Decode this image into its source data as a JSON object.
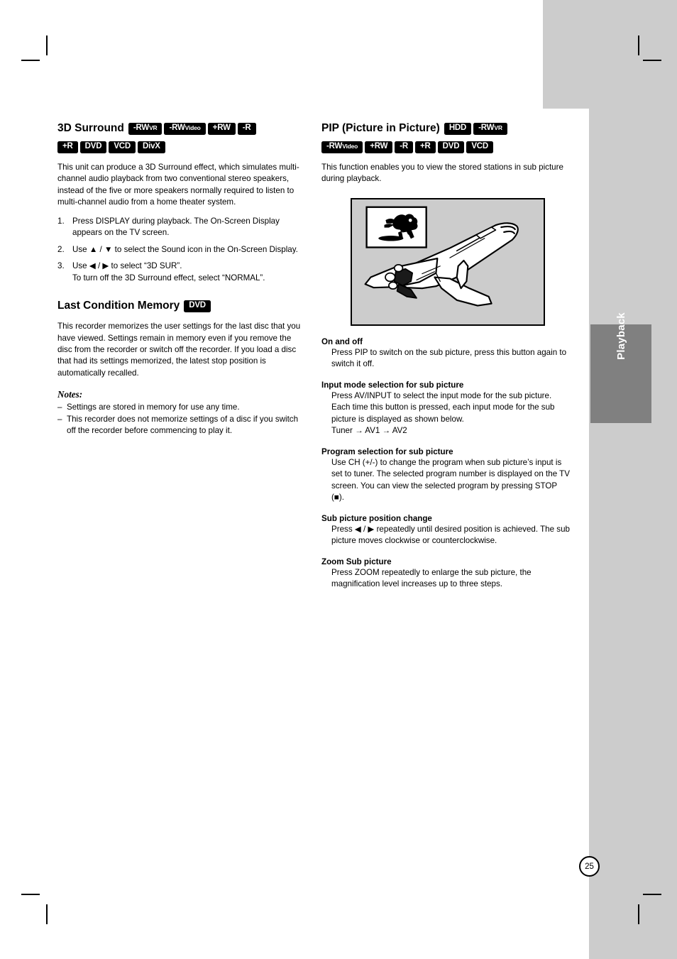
{
  "page": {
    "number": "25",
    "side_tab_label": "Playback"
  },
  "left_column": {
    "section1": {
      "title": "3D Surround",
      "badges": [
        {
          "main": "-RW",
          "sub": "VR"
        },
        {
          "main": "-RW",
          "sub": "Video"
        },
        {
          "main": "+RW",
          "sub": ""
        },
        {
          "main": "-R",
          "sub": ""
        },
        {
          "main": "+R",
          "sub": ""
        },
        {
          "main": "DVD",
          "sub": ""
        },
        {
          "main": "VCD",
          "sub": ""
        },
        {
          "main": "DivX",
          "sub": ""
        }
      ],
      "intro": "This unit can produce a 3D Surround effect, which simulates multi-channel audio playback from two conventional stereo speakers, instead of the five or more speakers normally required to listen to multi-channel audio from a home theater system.",
      "steps": [
        {
          "num": "1.",
          "text": "Press DISPLAY during playback. The On-Screen Display appears on the TV screen."
        },
        {
          "num": "2.",
          "text": "Use ▲ / ▼ to select the Sound icon in the On-Screen Display."
        },
        {
          "num": "3.",
          "text": "Use ◀ / ▶ to select “3D SUR”.\nTo turn off the 3D Surround effect, select “NORMAL”."
        }
      ]
    },
    "section2": {
      "title": "Last Condition Memory",
      "badges": [
        {
          "main": "DVD",
          "sub": ""
        }
      ],
      "intro": "This recorder memorizes the user settings for the last disc that you have viewed. Settings remain in memory even if you remove the disc from the recorder or switch off the recorder. If you load a disc that had its settings memorized, the latest stop position is automatically recalled.",
      "notes_title": "Notes:",
      "notes": [
        "Settings are stored in memory for use any time.",
        "This recorder does not memorize settings of a disc if you switch off the recorder before commencing to play it."
      ]
    }
  },
  "right_column": {
    "section1": {
      "title": "PIP (Picture in Picture)",
      "badges": [
        {
          "main": "HDD",
          "sub": ""
        },
        {
          "main": "-RW",
          "sub": "VR"
        },
        {
          "main": "-RW",
          "sub": "Video"
        },
        {
          "main": "+RW",
          "sub": ""
        },
        {
          "main": "-R",
          "sub": ""
        },
        {
          "main": "+R",
          "sub": ""
        },
        {
          "main": "DVD",
          "sub": ""
        },
        {
          "main": "VCD",
          "sub": ""
        }
      ],
      "intro": "This function enables you to view the stored stations in sub picture during playback.",
      "illustration_alt": "space-shuttle-with-pip-sub-picture-of-leaping-dog",
      "subsections": [
        {
          "heading": "On and off",
          "body": "Press PIP to switch on the sub picture, press this button again to switch it off."
        },
        {
          "heading": "Input mode selection for sub picture",
          "body": "Press AV/INPUT to select the input mode for the sub picture. Each time this button is pressed, each input mode for the sub picture is displayed as shown below.",
          "extra": "Tuner → AV1 → AV2"
        },
        {
          "heading": "Program selection for sub picture",
          "body": "Use CH (+/-) to change the program when sub picture’s input is set to tuner. The selected program number is displayed on the TV screen. You can view the selected program by pressing STOP (■)."
        },
        {
          "heading": "Sub picture position change",
          "body": "Press ◀ / ▶ repeatedly until desired position is achieved. The sub picture moves clockwise or counterclockwise."
        },
        {
          "heading": "Zoom Sub picture",
          "body": "Press ZOOM repeatedly to enlarge the sub picture, the magnification level increases up to three steps."
        }
      ]
    }
  },
  "colors": {
    "page_gray": "#cccccc",
    "tab_gray": "#808080",
    "badge_black": "#000000",
    "text_black": "#000000",
    "illustration_bg": "#cccccc"
  }
}
